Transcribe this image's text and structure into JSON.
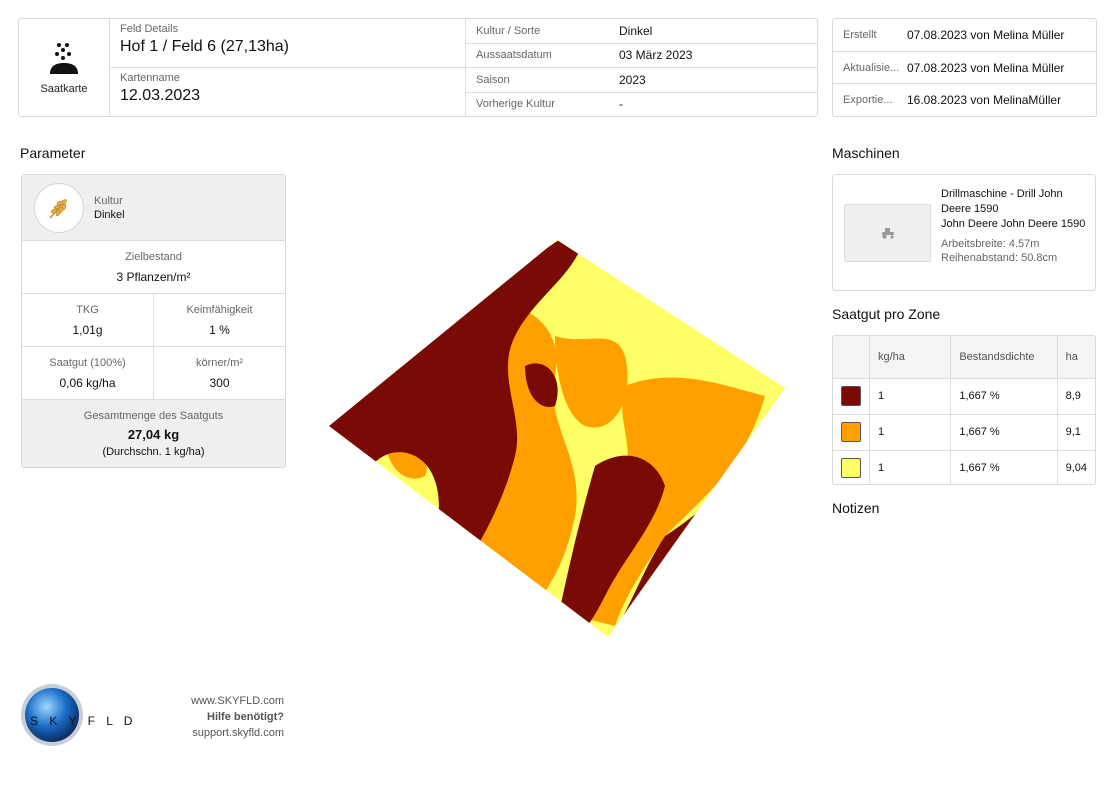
{
  "header": {
    "logo_label": "Saatkarte",
    "field_details_label": "Feld Details",
    "field_details_value": "Hof 1 / Feld 6 (27,13ha)",
    "map_name_label": "Kartenname",
    "map_name_value": "12.03.2023",
    "rows": [
      {
        "label": "Kultur / Sorte",
        "value": "Dinkel"
      },
      {
        "label": "Aussaatsdatum",
        "value": "03 März 2023"
      },
      {
        "label": "Saison",
        "value": "2023"
      },
      {
        "label": "Vorherige Kultur",
        "value": "-"
      }
    ]
  },
  "meta": [
    {
      "label": "Erstellt",
      "value": "07.08.2023 von Melina Müller"
    },
    {
      "label": "Aktualisie...",
      "value": "07.08.2023 von Melina Müller"
    },
    {
      "label": "Exportie...",
      "value": "16.08.2023 von MelinaMüller"
    }
  ],
  "parameter": {
    "title": "Parameter",
    "crop_label": "Kultur",
    "crop_value": "Dinkel",
    "target_label": "Zielbestand",
    "target_value": "3 Pflanzen/m²",
    "tkg_label": "TKG",
    "tkg_value": "1,01g",
    "germ_label": "Keimfähigkeit",
    "germ_value": "1 %",
    "seed_label": "Saatgut (100%)",
    "seed_value": "0,06 kg/ha",
    "grains_label": "körner/m²",
    "grains_value": "300",
    "total_label": "Gesamtmenge des Saatguts",
    "total_value": "27,04 kg",
    "total_avg": "(Durchschn. 1 kg/ha)"
  },
  "machines": {
    "title": "Maschinen",
    "name_line1": "Drillmaschine - Drill John Deere 1590",
    "name_line2": "John Deere John Deere 1590",
    "width": "Arbeitsbreite: 4.57m",
    "row_spacing": "Reihenabstand: 50.8cm"
  },
  "zones": {
    "title": "Saatgut pro Zone",
    "headers": [
      "",
      "kg/ha",
      "Bestandsdichte",
      "ha"
    ],
    "rows": [
      {
        "color": "#7a0a05",
        "kgha": "1",
        "density": "1,667 %",
        "ha": "8,9"
      },
      {
        "color": "#ffa000",
        "kgha": "1",
        "density": "1,667 %",
        "ha": "9,1"
      },
      {
        "color": "#ffff66",
        "kgha": "1",
        "density": "1,667 %",
        "ha": "9,04"
      }
    ]
  },
  "notes": {
    "title": "Notizen"
  },
  "map": {
    "zone_colors": [
      "#7a0a05",
      "#ffa000",
      "#ffff66"
    ]
  },
  "footer": {
    "brand": "S K Y F L D",
    "url": "www.SKYFLD.com",
    "help": "Hilfe benötigt?",
    "support": "support.skyfld.com"
  }
}
